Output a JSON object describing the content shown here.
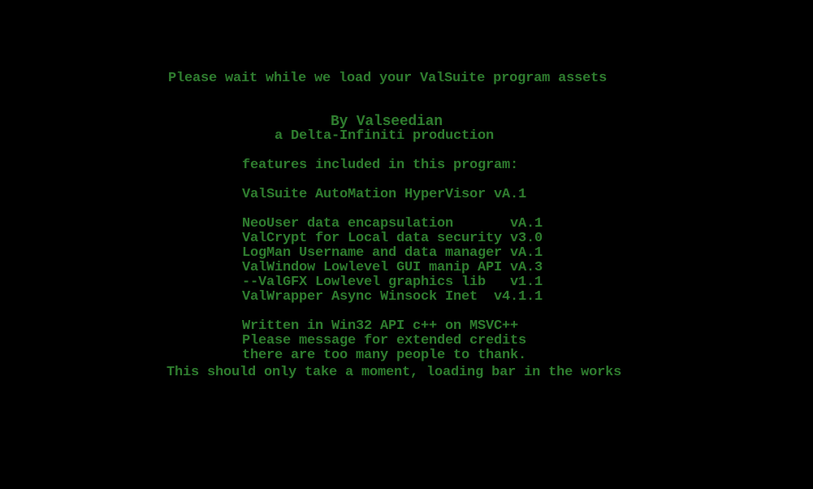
{
  "terminal": {
    "background": "#000000",
    "text_color": "#2f7d2f",
    "loading_message": "Please wait while we load your ValSuite program assets",
    "author": "By Valseedian",
    "production": "a Delta-Infiniti production",
    "features_heading": "features included in this program:",
    "main_feature": "ValSuite AutoMation HyperVisor vA.1",
    "features": [
      "NeoUser data encapsulation       vA.1",
      "ValCrypt for Local data security v3.0",
      "LogMan Username and data manager vA.1",
      "ValWindow Lowlevel GUI manip API vA.3",
      "--ValGFX Lowlevel graphics lib   v1.1",
      "ValWrapper Async Winsock Inet  v4.1.1"
    ],
    "credits": [
      "Written in Win32 API c++ on MSVC++",
      "Please message for extended credits",
      "there are too many people to thank."
    ],
    "footer_message": "This should only take a moment, loading bar in the works"
  }
}
